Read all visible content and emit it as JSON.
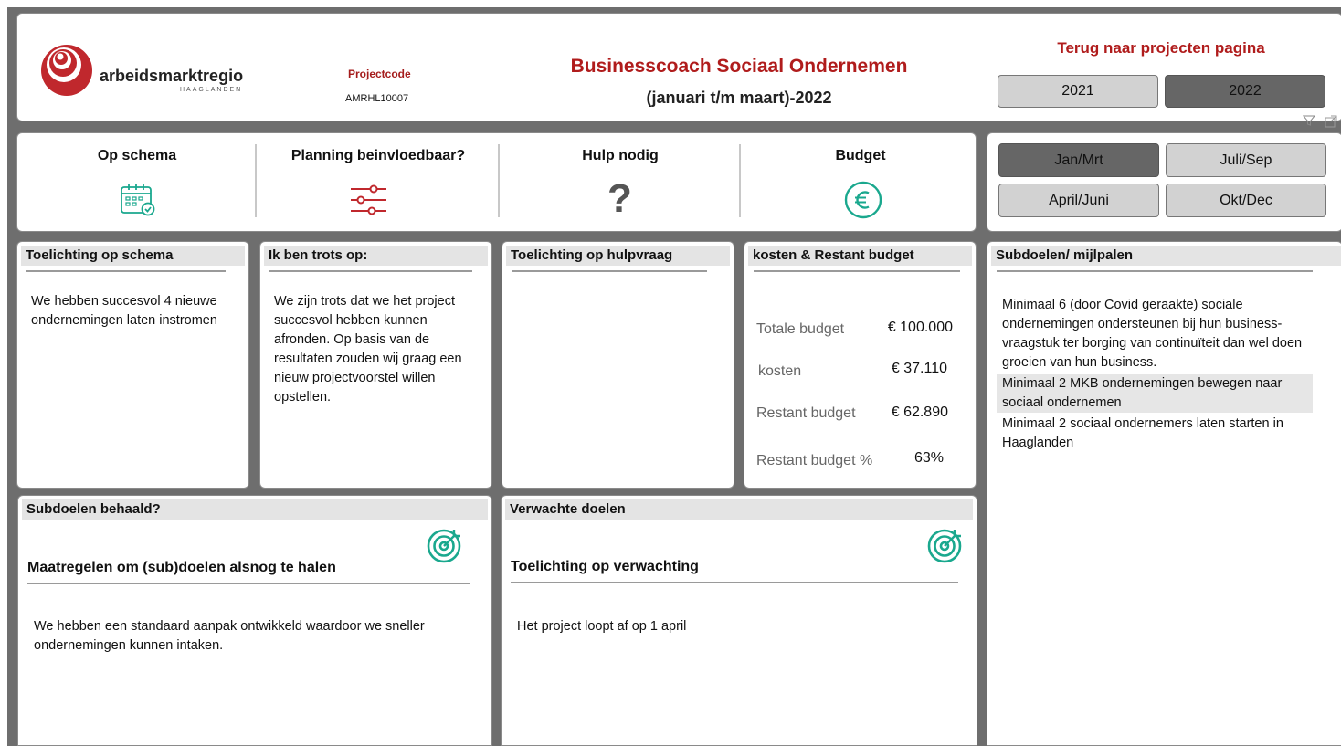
{
  "header": {
    "brand_name": "arbeidsmarktregio",
    "brand_sub": "HAAGLANDEN",
    "projectcode_label": "Projectcode",
    "projectcode_value": "AMRHL10007",
    "title": "Businesscoach Sociaal Ondernemen",
    "subtitle": "(januari t/m maart)-2022",
    "back_link": "Terug naar projecten pagina",
    "years": [
      "2021",
      "2022"
    ],
    "active_year": "2022"
  },
  "quarters": {
    "q1": "Jan/Mrt",
    "q2": "April/Juni",
    "q3": "Juli/Sep",
    "q4": "Okt/Dec",
    "active": "Jan/Mrt"
  },
  "status": {
    "op_schema": "Op schema",
    "planning": "Planning beinvloedbaar?",
    "hulp": "Hulp nodig",
    "budget": "Budget",
    "icons": [
      "calendar-check-icon",
      "sliders-icon",
      "question-mark-icon",
      "euro-icon"
    ],
    "accent_red": "#c0282d",
    "accent_teal": "#1aa88e"
  },
  "panels": {
    "schema_title": "Toelichting op schema",
    "schema_text": "We hebben succesvol 4 nieuwe ondernemingen laten instromen",
    "trots_title": "Ik ben trots op:",
    "trots_text": "We zijn trots dat we het project succesvol hebben kunnen afronden. Op basis van de resultaten zouden wij graag een nieuw projectvoorstel willen opstellen.",
    "hulp_title": "Toelichting op hulpvraag",
    "kosten_title": "kosten & Restant budget",
    "budget_rows": [
      {
        "label": "Totale budget",
        "value": "€ 100.000"
      },
      {
        "label": "kosten",
        "value": "€ 37.110"
      },
      {
        "label": "Restant budget",
        "value": "€ 62.890"
      },
      {
        "label": "Restant budget %",
        "value": "63%"
      }
    ],
    "subdoelen_title": "Subdoelen/ mijlpalen",
    "subdoelen": [
      "Minimaal 6 (door Covid geraakte) sociale ondernemingen ondersteunen bij hun business-vraagstuk ter borging van continuïteit dan wel doen groeien van hun business.",
      "Minimaal 2 MKB ondernemingen bewegen naar sociaal ondernemen",
      "Minimaal 2 sociaal ondernemers laten starten in Haaglanden"
    ],
    "behaald_title": "Subdoelen behaald?",
    "maatregelen_title": "Maatregelen om (sub)doelen alsnog te halen",
    "maatregelen_text": "We hebben een standaard aanpak ontwikkeld waardoor we sneller ondernemingen kunnen intaken.",
    "verwacht_title": "Verwachte doelen",
    "verwachting_title": "Toelichting op verwachting",
    "verwachting_text": "Het project loopt af op 1 april"
  }
}
